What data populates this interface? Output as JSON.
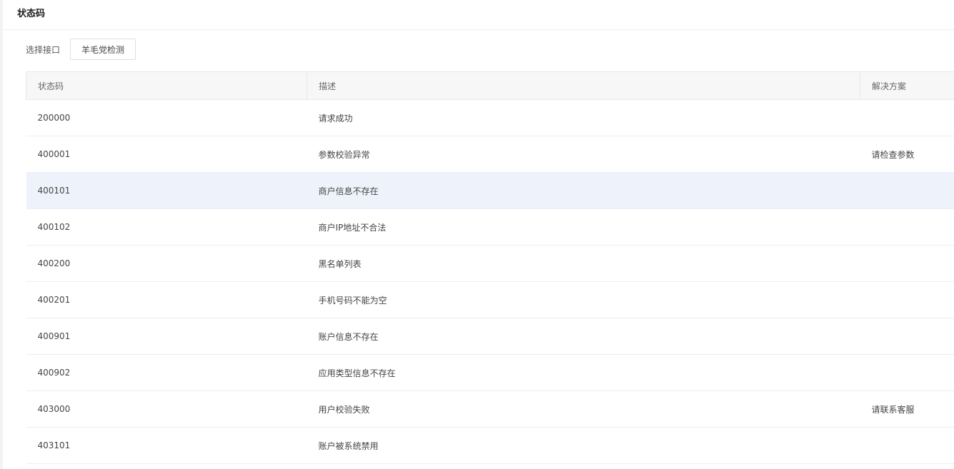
{
  "card": {
    "title": "状态码"
  },
  "filter": {
    "label": "选择接口",
    "button_label": "羊毛党检测"
  },
  "table": {
    "headers": {
      "code": "状态码",
      "description": "描述",
      "solution": "解决方案"
    },
    "rows": [
      {
        "code": "200000",
        "description": "请求成功",
        "solution": ""
      },
      {
        "code": "400001",
        "description": "参数校验异常",
        "solution": "请检查参数"
      },
      {
        "code": "400101",
        "description": "商户信息不存在",
        "solution": ""
      },
      {
        "code": "400102",
        "description": "商户IP地址不合法",
        "solution": ""
      },
      {
        "code": "400200",
        "description": "黑名单列表",
        "solution": ""
      },
      {
        "code": "400201",
        "description": "手机号码不能为空",
        "solution": ""
      },
      {
        "code": "400901",
        "description": "账户信息不存在",
        "solution": ""
      },
      {
        "code": "400902",
        "description": "应用类型信息不存在",
        "solution": ""
      },
      {
        "code": "403000",
        "description": "用户校验失败",
        "solution": "请联系客服"
      },
      {
        "code": "403101",
        "description": "账户被系统禁用",
        "solution": ""
      }
    ],
    "highlighted_row_index": 2
  },
  "colors": {
    "highlight_row": "#eef3fb",
    "header_bg": "#f7f7f7"
  }
}
